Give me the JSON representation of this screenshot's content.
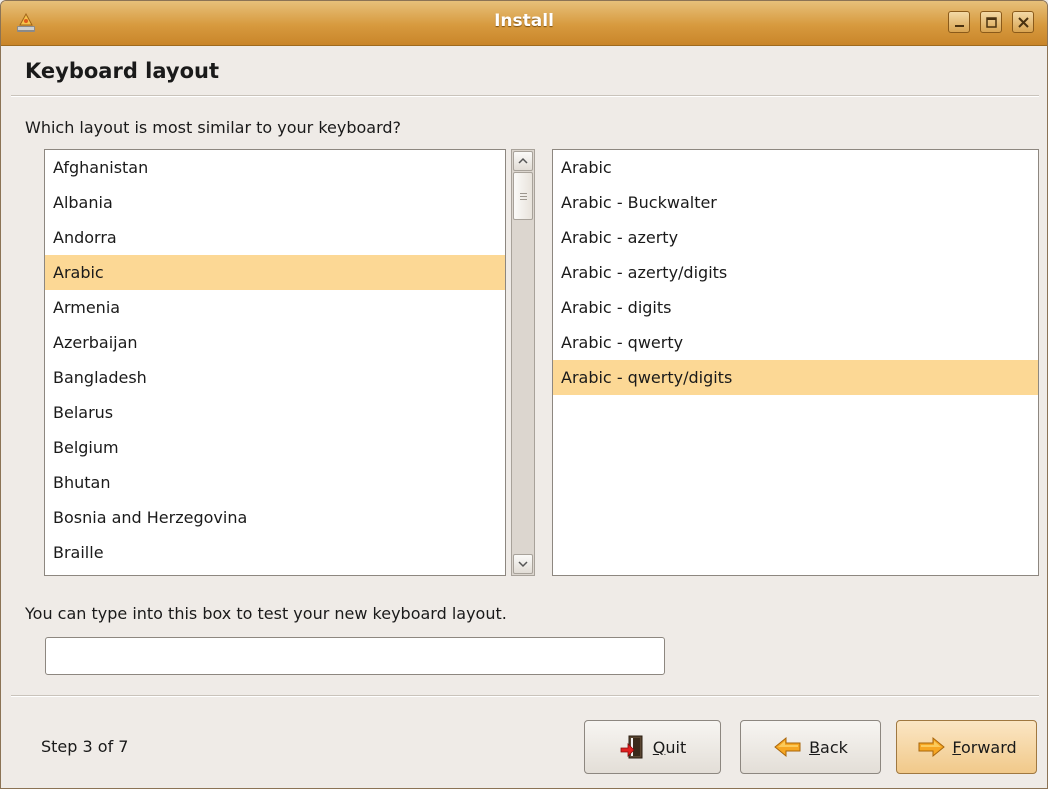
{
  "window": {
    "title": "Install",
    "app_icon": "installer-icon",
    "controls": [
      "minimize-icon",
      "maximize-icon",
      "close-icon"
    ]
  },
  "page": {
    "heading": "Keyboard layout",
    "question": "Which layout is most similar to your keyboard?",
    "test_hint": "You can type into this box to test your new keyboard layout.",
    "test_value": "",
    "step_text": "Step 3 of 7"
  },
  "countries": [
    {
      "label": "Afghanistan",
      "selected": false
    },
    {
      "label": "Albania",
      "selected": false
    },
    {
      "label": "Andorra",
      "selected": false
    },
    {
      "label": "Arabic",
      "selected": true
    },
    {
      "label": "Armenia",
      "selected": false
    },
    {
      "label": "Azerbaijan",
      "selected": false
    },
    {
      "label": "Bangladesh",
      "selected": false
    },
    {
      "label": "Belarus",
      "selected": false
    },
    {
      "label": "Belgium",
      "selected": false
    },
    {
      "label": "Bhutan",
      "selected": false
    },
    {
      "label": "Bosnia and Herzegovina",
      "selected": false
    },
    {
      "label": "Braille",
      "selected": false
    }
  ],
  "variants": [
    {
      "label": "Arabic",
      "selected": false
    },
    {
      "label": "Arabic - Buckwalter",
      "selected": false
    },
    {
      "label": "Arabic - azerty",
      "selected": false
    },
    {
      "label": "Arabic - azerty/digits",
      "selected": false
    },
    {
      "label": "Arabic - digits",
      "selected": false
    },
    {
      "label": "Arabic - qwerty",
      "selected": false
    },
    {
      "label": "Arabic - qwerty/digits",
      "selected": true
    }
  ],
  "buttons": {
    "quit": {
      "mnemonic": "Q",
      "rest": "uit",
      "icon": "quit-door-icon"
    },
    "back": {
      "mnemonic": "B",
      "rest": "ack",
      "icon": "back-arrow-icon"
    },
    "forward": {
      "mnemonic": "F",
      "rest": "orward",
      "icon": "forward-arrow-icon"
    }
  },
  "colors": {
    "titlebar": "#d79a3e",
    "selection": "#fcd895",
    "window_bg": "#efebe7"
  }
}
